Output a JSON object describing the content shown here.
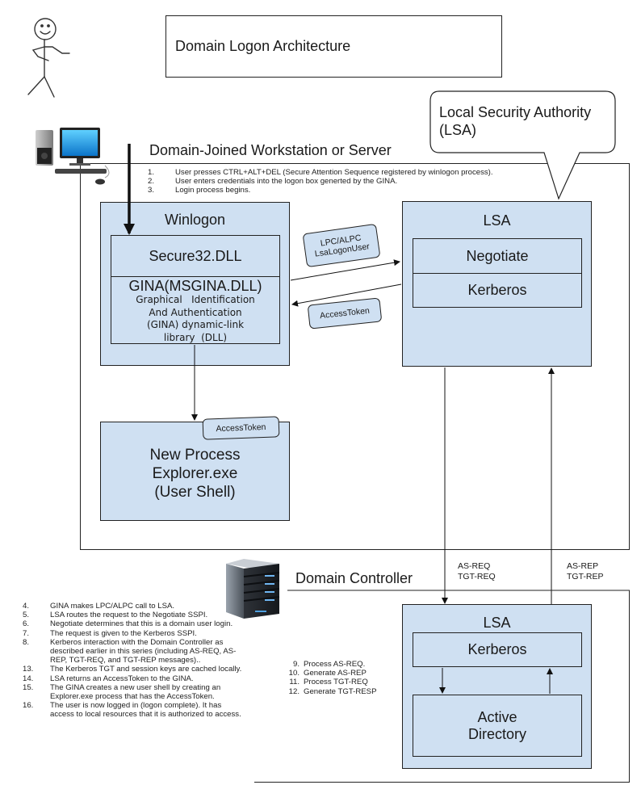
{
  "title": "Domain Logon Architecture",
  "callout": {
    "line1": "Local  Security Authority",
    "line2": "(LSA)"
  },
  "workstation": {
    "title": "Domain-Joined Workstation or Server",
    "icon": "desktop-computer-icon",
    "steps": [
      {
        "num": "1.",
        "text": "User presses CTRL+ALT+DEL (Secure Attention Sequence registered by winlogon process)."
      },
      {
        "num": "2.",
        "text": "User enters credentials into the logon box generted by the GINA."
      },
      {
        "num": "3.",
        "text": "Login process begins."
      }
    ],
    "winlogon": {
      "title": "Winlogon",
      "secure32": "Secure32.DLL",
      "gina_title": "GINA(MSGINA.DLL)",
      "gina_desc": [
        "Graphical   Identification",
        "And Authentication",
        "(GINA) dynamic-link",
        "library  (DLL)"
      ]
    },
    "lsa": {
      "title": "LSA",
      "negotiate": "Negotiate",
      "kerberos": "Kerberos"
    },
    "lpc_tag": [
      "LPC/ALPC",
      "LsaLogonUser"
    ],
    "access_token_tag": "AccessToken",
    "new_process": {
      "lines": [
        "New Process",
        "Explorer.exe",
        "(User Shell)"
      ],
      "token_tag": "AccessToken"
    }
  },
  "links": {
    "request": [
      "AS-REQ",
      "TGT-REQ"
    ],
    "reply": [
      "AS-REP",
      "TGT-REP"
    ]
  },
  "domain_controller": {
    "title": "Domain Controller",
    "icon": "server-tower-icon",
    "steps": [
      {
        "num": "9.",
        "text": "Process AS-REQ."
      },
      {
        "num": "10.",
        "text": "Generate AS-REP"
      },
      {
        "num": "11.",
        "text": "Process TGT-REQ"
      },
      {
        "num": "12.",
        "text": "Generate TGT-RESP"
      }
    ],
    "lsa": {
      "title": "LSA",
      "kerberos": "Kerberos",
      "active_directory": [
        "Active",
        "Directory"
      ]
    }
  },
  "notes": [
    {
      "num": "4.",
      "text": "GINA makes LPC/ALPC call to LSA."
    },
    {
      "num": "5.",
      "text": "LSA routes the request to the Negotiate SSPI."
    },
    {
      "num": "6.",
      "text": "Negotiate determines that this is a domain user login."
    },
    {
      "num": "7.",
      "text": "The request is given to the Kerberos SSPI."
    },
    {
      "num": "8.",
      "text": "Kerberos interaction with the Domain Controller as described earlier in this series (including AS-REQ, AS-REP, TGT-REQ, and TGT-REP messages).."
    },
    {
      "num": "13.",
      "text": "The Kerberos TGT and session keys are cached locally."
    },
    {
      "num": "14.",
      "text": "LSA returns an AccessToken to the GINA."
    },
    {
      "num": "15.",
      "text": "The GINA creates a new user shell by creating an Explorer.exe process that has the AccessToken."
    },
    {
      "num": "16.",
      "text": "The user is now logged in (logon complete). It has access to local resources that it is authorized to access."
    }
  ],
  "user_figure": "stick-figure-user-icon"
}
